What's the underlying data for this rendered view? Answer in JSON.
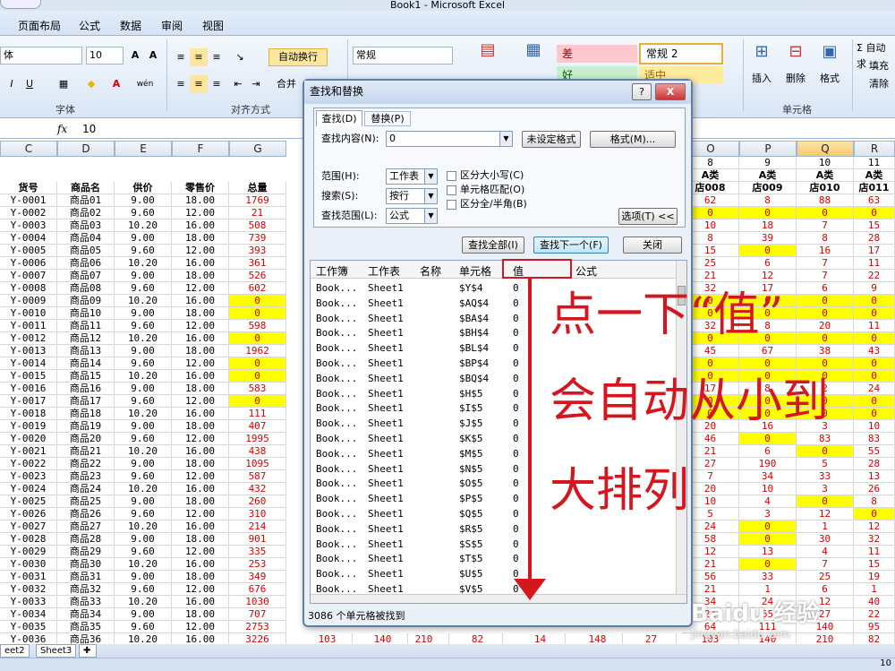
{
  "window": {
    "title": "Book1 - Microsoft Excel"
  },
  "menu": [
    "页面布局",
    "公式",
    "数据",
    "审阅",
    "视图"
  ],
  "ribbon": {
    "font_name": "体",
    "font_size": "10",
    "wrap_text": "自动换行",
    "merge": "合并",
    "number_format": "常规",
    "styles": {
      "bad": "差",
      "normal2": "常规 2",
      "good": "好",
      "neutral": "适中"
    },
    "cond_format": "条件格式",
    "table_format": "套用",
    "insert": "插入",
    "delete": "删除",
    "format": "格式",
    "sum": "Σ 自动求",
    "fill": "填充",
    "clear": "清除",
    "groups": {
      "font": "字体",
      "alignment": "对齐方式",
      "cells": "单元格"
    }
  },
  "formula_bar": {
    "fx": "fx",
    "value": "10"
  },
  "columns": {
    "left": [
      "C",
      "D",
      "E",
      "F",
      "G"
    ],
    "right": [
      "O",
      "P",
      "Q",
      "R"
    ],
    "selected": "Q"
  },
  "sheet": {
    "headers": [
      "货号",
      "商品名",
      "供价",
      "零售价",
      "总量"
    ],
    "right_top": [
      [
        "8",
        "9",
        "10",
        "11"
      ],
      [
        "A类",
        "A类",
        "A类",
        "A类"
      ],
      [
        "店008",
        "店009",
        "店010",
        "店011"
      ]
    ],
    "rows": [
      [
        "Y-0001",
        "商品01",
        "9.00",
        "18.00",
        "1769",
        "62",
        "8",
        "88",
        "63"
      ],
      [
        "Y-0002",
        "商品02",
        "9.60",
        "12.00",
        "21",
        "0",
        "0",
        "0",
        "0"
      ],
      [
        "Y-0003",
        "商品03",
        "10.20",
        "16.00",
        "508",
        "10",
        "18",
        "7",
        "15"
      ],
      [
        "Y-0004",
        "商品04",
        "9.00",
        "18.00",
        "739",
        "8",
        "39",
        "8",
        "28"
      ],
      [
        "Y-0005",
        "商品05",
        "9.60",
        "12.00",
        "393",
        "15",
        "0",
        "16",
        "17"
      ],
      [
        "Y-0006",
        "商品06",
        "10.20",
        "16.00",
        "361",
        "25",
        "6",
        "7",
        "11"
      ],
      [
        "Y-0007",
        "商品07",
        "9.00",
        "18.00",
        "526",
        "21",
        "12",
        "7",
        "22"
      ],
      [
        "Y-0008",
        "商品08",
        "9.60",
        "12.00",
        "602",
        "32",
        "17",
        "6",
        "9"
      ],
      [
        "Y-0009",
        "商品09",
        "10.20",
        "16.00",
        "0",
        "0",
        "0",
        "0",
        "0"
      ],
      [
        "Y-0010",
        "商品10",
        "9.00",
        "18.00",
        "0",
        "0",
        "0",
        "0",
        "0"
      ],
      [
        "Y-0011",
        "商品11",
        "9.60",
        "12.00",
        "598",
        "32",
        "8",
        "20",
        "11"
      ],
      [
        "Y-0012",
        "商品12",
        "10.20",
        "16.00",
        "0",
        "0",
        "0",
        "0",
        "0"
      ],
      [
        "Y-0013",
        "商品13",
        "9.00",
        "18.00",
        "1962",
        "45",
        "67",
        "38",
        "43"
      ],
      [
        "Y-0014",
        "商品14",
        "9.60",
        "12.00",
        "0",
        "0",
        "0",
        "0",
        "0"
      ],
      [
        "Y-0015",
        "商品15",
        "10.20",
        "16.00",
        "0",
        "0",
        "0",
        "0",
        "0"
      ],
      [
        "Y-0016",
        "商品16",
        "9.00",
        "18.00",
        "583",
        "17",
        "8",
        "2",
        "24"
      ],
      [
        "Y-0017",
        "商品17",
        "9.60",
        "12.00",
        "0",
        "0",
        "0",
        "0",
        "0"
      ],
      [
        "Y-0018",
        "商品18",
        "10.20",
        "16.00",
        "111",
        "0",
        "0",
        "0",
        "0"
      ],
      [
        "Y-0019",
        "商品19",
        "9.00",
        "18.00",
        "407",
        "20",
        "16",
        "3",
        "10"
      ],
      [
        "Y-0020",
        "商品20",
        "9.60",
        "12.00",
        "1995",
        "46",
        "0",
        "83",
        "83"
      ],
      [
        "Y-0021",
        "商品21",
        "10.20",
        "16.00",
        "438",
        "21",
        "6",
        "0",
        "55"
      ],
      [
        "Y-0022",
        "商品22",
        "9.00",
        "18.00",
        "1095",
        "27",
        "190",
        "5",
        "28"
      ],
      [
        "Y-0023",
        "商品23",
        "9.60",
        "12.00",
        "587",
        "7",
        "34",
        "33",
        "13"
      ],
      [
        "Y-0024",
        "商品24",
        "10.20",
        "16.00",
        "432",
        "20",
        "10",
        "3",
        "26"
      ],
      [
        "Y-0025",
        "商品25",
        "9.00",
        "18.00",
        "260",
        "10",
        "4",
        "0",
        "8"
      ],
      [
        "Y-0026",
        "商品26",
        "9.60",
        "12.00",
        "310",
        "5",
        "3",
        "12",
        "0"
      ],
      [
        "Y-0027",
        "商品27",
        "10.20",
        "16.00",
        "214",
        "24",
        "0",
        "1",
        "12"
      ],
      [
        "Y-0028",
        "商品28",
        "9.00",
        "18.00",
        "901",
        "58",
        "0",
        "30",
        "32"
      ],
      [
        "Y-0029",
        "商品29",
        "9.60",
        "12.00",
        "335",
        "12",
        "13",
        "4",
        "11"
      ],
      [
        "Y-0030",
        "商品30",
        "10.20",
        "16.00",
        "253",
        "21",
        "0",
        "7",
        "15"
      ],
      [
        "Y-0031",
        "商品31",
        "9.00",
        "18.00",
        "349",
        "56",
        "33",
        "25",
        "19"
      ],
      [
        "Y-0032",
        "商品32",
        "9.60",
        "12.00",
        "676",
        "21",
        "1",
        "6",
        "1"
      ],
      [
        "Y-0033",
        "商品33",
        "10.20",
        "16.00",
        "1030",
        "34",
        "24",
        "12",
        "40"
      ],
      [
        "Y-0034",
        "商品34",
        "9.00",
        "18.00",
        "707",
        "21",
        "65",
        "27",
        "22"
      ],
      [
        "Y-0035",
        "商品35",
        "9.60",
        "12.00",
        "2753",
        "64",
        "111",
        "140",
        "95"
      ],
      [
        "Y-0036",
        "商品36",
        "10.20",
        "16.00",
        "3226",
        "103",
        "140",
        "210",
        "82"
      ]
    ],
    "bottom_row_mid": [
      "103",
      "140",
      "210",
      "82",
      "14",
      "148",
      "27"
    ]
  },
  "sheet_tabs": [
    "eet2",
    "Sheet3"
  ],
  "dialog": {
    "title": "查找和替换",
    "help": "?",
    "close": "X",
    "tabs": [
      "查找(D)",
      "替换(P)"
    ],
    "find_label": "查找内容(N):",
    "find_value": "0",
    "no_format": "未设定格式",
    "format_btn": "格式(M)...",
    "scope_label": "范围(H):",
    "scope_value": "工作表",
    "search_label": "搜索(S):",
    "search_value": "按行",
    "lookin_label": "查找范围(L):",
    "lookin_value": "公式",
    "match_case": "区分大小写(C)",
    "match_cell": "单元格匹配(O)",
    "match_width": "区分全/半角(B)",
    "options_btn": "选项(T) <<",
    "find_all": "查找全部(I)",
    "find_next": "查找下一个(F)",
    "close_btn": "关闭",
    "cols": [
      "工作簿",
      "工作表",
      "名称",
      "单元格",
      "值",
      "公式"
    ],
    "results": [
      [
        "Book...",
        "Sheet1",
        "$Y$4",
        "0"
      ],
      [
        "Book...",
        "Sheet1",
        "$AQ$4",
        "0"
      ],
      [
        "Book...",
        "Sheet1",
        "$BA$4",
        "0"
      ],
      [
        "Book...",
        "Sheet1",
        "$BH$4",
        "0"
      ],
      [
        "Book...",
        "Sheet1",
        "$BL$4",
        "0"
      ],
      [
        "Book...",
        "Sheet1",
        "$BP$4",
        "0"
      ],
      [
        "Book...",
        "Sheet1",
        "$BQ$4",
        "0"
      ],
      [
        "Book...",
        "Sheet1",
        "$H$5",
        "0"
      ],
      [
        "Book...",
        "Sheet1",
        "$I$5",
        "0"
      ],
      [
        "Book...",
        "Sheet1",
        "$J$5",
        "0"
      ],
      [
        "Book...",
        "Sheet1",
        "$K$5",
        "0"
      ],
      [
        "Book...",
        "Sheet1",
        "$M$5",
        "0"
      ],
      [
        "Book...",
        "Sheet1",
        "$N$5",
        "0"
      ],
      [
        "Book...",
        "Sheet1",
        "$O$5",
        "0"
      ],
      [
        "Book...",
        "Sheet1",
        "$P$5",
        "0"
      ],
      [
        "Book...",
        "Sheet1",
        "$Q$5",
        "0"
      ],
      [
        "Book...",
        "Sheet1",
        "$R$5",
        "0"
      ],
      [
        "Book...",
        "Sheet1",
        "$S$5",
        "0"
      ],
      [
        "Book...",
        "Sheet1",
        "$T$5",
        "0"
      ],
      [
        "Book...",
        "Sheet1",
        "$U$5",
        "0"
      ],
      [
        "Book...",
        "Sheet1",
        "$V$5",
        "0"
      ]
    ],
    "status": "3086 个单元格被找到"
  },
  "annotation": [
    "点一下“值”",
    "会自动从小到",
    "大排列"
  ],
  "watermark": {
    "brand": "Baidu 经验",
    "url": "jingyan.baidu.com"
  },
  "status_zoom": "10"
}
